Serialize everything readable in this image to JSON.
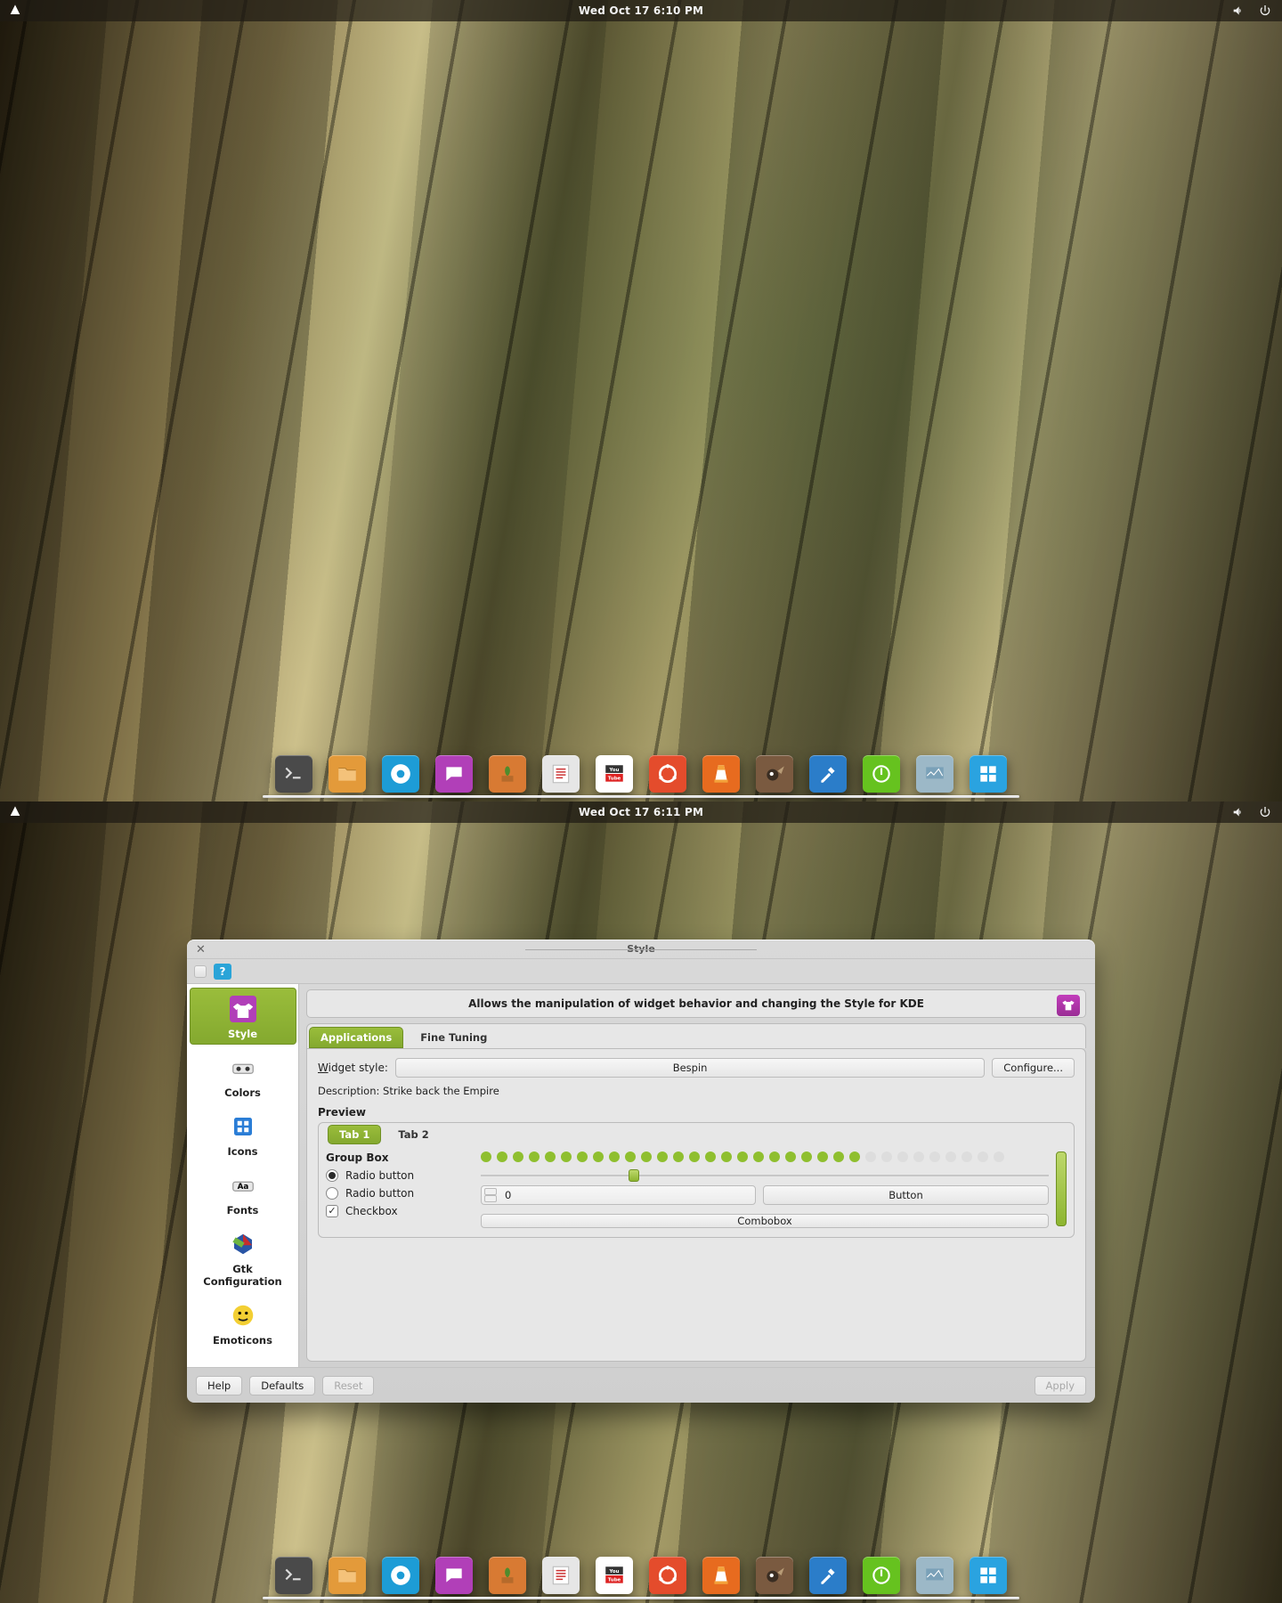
{
  "screens": [
    {
      "clock": "Wed Oct 17 6:10 PM"
    },
    {
      "clock": "Wed Oct 17 6:11 PM"
    }
  ],
  "dock_items": [
    {
      "name": "terminal",
      "bg": "#4a4a4a"
    },
    {
      "name": "files",
      "bg": "#e39a3a"
    },
    {
      "name": "chromium",
      "bg": "#1d9cd6"
    },
    {
      "name": "chat",
      "bg": "#b13fb8"
    },
    {
      "name": "plant",
      "bg": "#d87a33"
    },
    {
      "name": "editor",
      "bg": "#e6e6e6"
    },
    {
      "name": "youtube",
      "bg": "#ffffff"
    },
    {
      "name": "ubuntu-one",
      "bg": "#e44c2c"
    },
    {
      "name": "vlc",
      "bg": "#e76b1f"
    },
    {
      "name": "gimp",
      "bg": "#7a5a40"
    },
    {
      "name": "color-pick",
      "bg": "#2b7dc9"
    },
    {
      "name": "logout",
      "bg": "#66c21f"
    },
    {
      "name": "monitor",
      "bg": "#9cb8c7"
    },
    {
      "name": "tiling",
      "bg": "#2aa3e0"
    }
  ],
  "style_window": {
    "title": "Style",
    "heading": "Allows the manipulation of widget behavior and changing the Style for KDE",
    "subtabs": {
      "applications": "Applications",
      "fine_tuning": "Fine Tuning"
    },
    "widget_style_label": "Widget style:",
    "widget_style_value": "Bespin",
    "configure_btn": "Configure...",
    "description": "Description: Strike back the Empire",
    "preview_title": "Preview",
    "categories": [
      {
        "key": "style",
        "label": "Style",
        "active": true
      },
      {
        "key": "colors",
        "label": "Colors"
      },
      {
        "key": "icons",
        "label": "Icons"
      },
      {
        "key": "fonts",
        "label": "Fonts"
      },
      {
        "key": "gtk",
        "label": "Gtk\nConfiguration"
      },
      {
        "key": "emoticons",
        "label": "Emoticons"
      }
    ],
    "preview": {
      "tab1": "Tab 1",
      "tab2": "Tab 2",
      "group_title": "Group Box",
      "radio1": "Radio button",
      "radio2": "Radio button",
      "checkbox": "Checkbox",
      "spin_value": "0",
      "button": "Button",
      "combobox": "Combobox",
      "green_dots": 24,
      "grey_dots": 9
    },
    "buttons": {
      "help": "Help",
      "defaults": "Defaults",
      "reset": "Reset",
      "apply": "Apply"
    }
  }
}
